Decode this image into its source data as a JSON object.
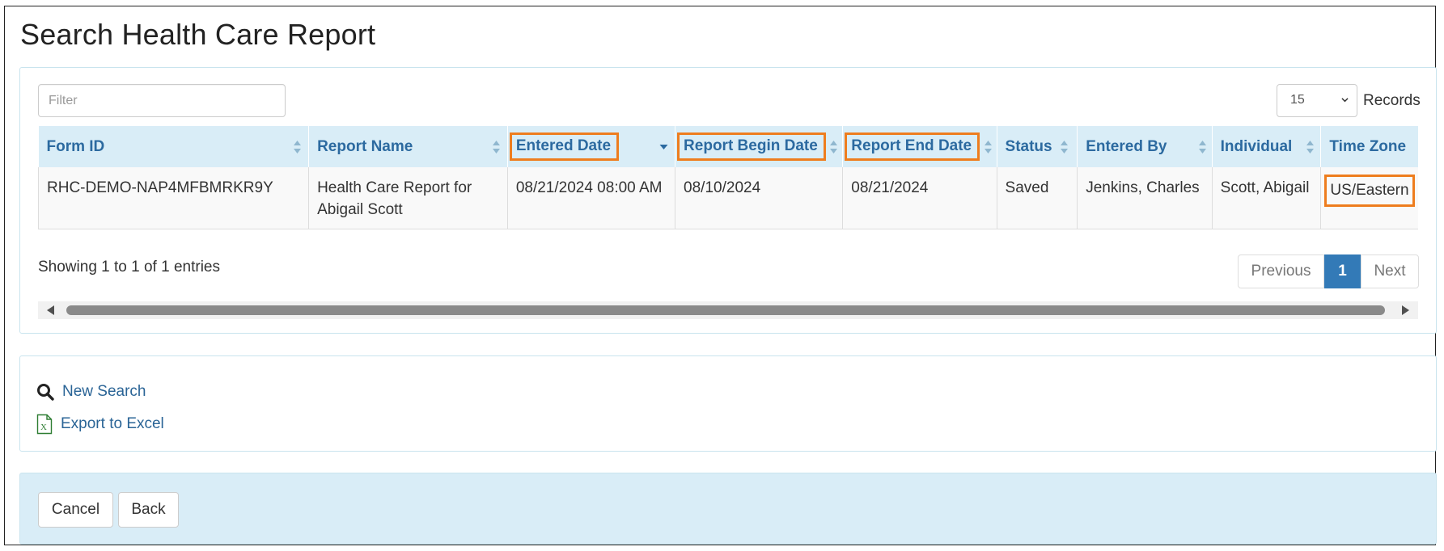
{
  "page": {
    "title": "Search Health Care Report"
  },
  "filter": {
    "placeholder": "Filter",
    "value": ""
  },
  "records": {
    "selected": "15",
    "label": "Records"
  },
  "table": {
    "columns": [
      {
        "label": "Form ID",
        "sort": "both",
        "highlighted": false
      },
      {
        "label": "Report Name",
        "sort": "both",
        "highlighted": false
      },
      {
        "label": "Entered Date",
        "sort": "desc",
        "highlighted": true
      },
      {
        "label": "Report Begin Date",
        "sort": "both",
        "highlighted": true
      },
      {
        "label": "Report End Date",
        "sort": "both",
        "highlighted": true
      },
      {
        "label": "Status",
        "sort": "both",
        "highlighted": false
      },
      {
        "label": "Entered By",
        "sort": "both",
        "highlighted": false
      },
      {
        "label": "Individual",
        "sort": "both",
        "highlighted": false
      },
      {
        "label": "Time Zone",
        "sort": "none",
        "highlighted": false
      }
    ],
    "rows": [
      {
        "form_id": "RHC-DEMO-NAP4MFBMRKR9Y",
        "report_name": "Health Care Report for Abigail Scott",
        "entered_date": "08/21/2024 08:00 AM",
        "report_begin_date": "08/10/2024",
        "report_end_date": "08/21/2024",
        "status": "Saved",
        "entered_by": "Jenkins, Charles",
        "individual": "Scott, Abigail",
        "time_zone": "US/Eastern"
      }
    ]
  },
  "pagination": {
    "info": "Showing 1 to 1 of 1 entries",
    "previous": "Previous",
    "current": "1",
    "next": "Next"
  },
  "actions": {
    "new_search": "New Search",
    "export_excel": "Export to Excel"
  },
  "footer": {
    "cancel": "Cancel",
    "back": "Back"
  },
  "colors": {
    "header_bg": "#d9edf7",
    "header_text": "#2c6aa0",
    "highlight_box": "#ee7d1e",
    "link": "#2a6496",
    "active_page": "#337ab7"
  },
  "icons": {
    "sort": "sort-both-icon",
    "sort_desc": "sort-desc-icon",
    "search": "search-icon",
    "excel": "excel-file-icon"
  }
}
